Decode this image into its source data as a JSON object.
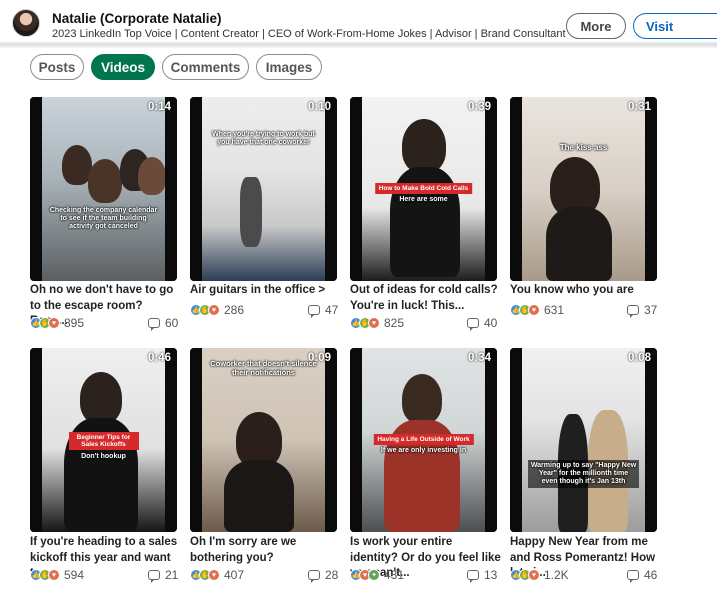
{
  "profile": {
    "name": "Natalie (Corporate Natalie)",
    "headline": "2023 LinkedIn Top Voice | Content Creator | CEO of Work-From-Home Jokes | Advisor | Brand Consultant",
    "more_label": "More",
    "visit_label": "Visit"
  },
  "filters": [
    "Posts",
    "Videos",
    "Comments",
    "Images"
  ],
  "active_filter": "Videos",
  "videos": [
    {
      "duration": "0:14",
      "title": "Oh no we don't have to go to the escape room? Ross...",
      "reactions": 895,
      "reaction_label": "895",
      "comments": "60",
      "caption": "Checking the company calendar to see if the team building activity got canceled",
      "label": ""
    },
    {
      "duration": "0:10",
      "title": "Air guitars in the office >",
      "reactions": 286,
      "reaction_label": "286",
      "comments": "47",
      "caption": "When you're trying to work but you have that one coworker",
      "label": ""
    },
    {
      "duration": "0:39",
      "title": "Out of ideas for cold calls? You're in luck! This...",
      "reactions": 825,
      "reaction_label": "825",
      "comments": "40",
      "caption": "Here are some",
      "label": "How to Make Bold Cold Calls"
    },
    {
      "duration": "0:31",
      "title": "You know who you are",
      "reactions": 631,
      "reaction_label": "631",
      "comments": "37",
      "caption": "The kiss ass",
      "label": ""
    },
    {
      "duration": "0:46",
      "title": "If you're heading to a sales kickoff this year and want t...",
      "reactions": 594,
      "reaction_label": "594",
      "comments": "21",
      "caption": "Don't hookup",
      "label": "Beginner Tips for Sales Kickoffs"
    },
    {
      "duration": "0:09",
      "title": "Oh I'm sorry are we bothering you?",
      "reactions": 407,
      "reaction_label": "407",
      "comments": "28",
      "caption": "Coworker that doesn't silence their notifications",
      "label": ""
    },
    {
      "duration": "0:34",
      "title": "Is work your entire identity? Or do you feel like you can't...",
      "reactions": 431,
      "reaction_label": "431",
      "comments": "13",
      "caption": "If we are only investing in",
      "label": "Having a Life Outside of Work"
    },
    {
      "duration": "0:08",
      "title": "Happy New Year from me and Ross Pomerantz! How late i...",
      "reactions": 1200,
      "reaction_label": "1.2K",
      "comments": "46",
      "caption": "Warming up to say \"Happy New Year\" for the millionth time even though it's Jan 13th",
      "label": ""
    }
  ],
  "colors": {
    "brand_green": "#01754f",
    "linkedin_blue": "#0a66c2",
    "reaction_like": "#378fe9",
    "reaction_love": "#df704d",
    "reaction_clap": "#6dae4f"
  },
  "icons": {
    "reactions": [
      "like-icon",
      "clap-icon",
      "love-icon"
    ],
    "comments": "comment-icon"
  }
}
